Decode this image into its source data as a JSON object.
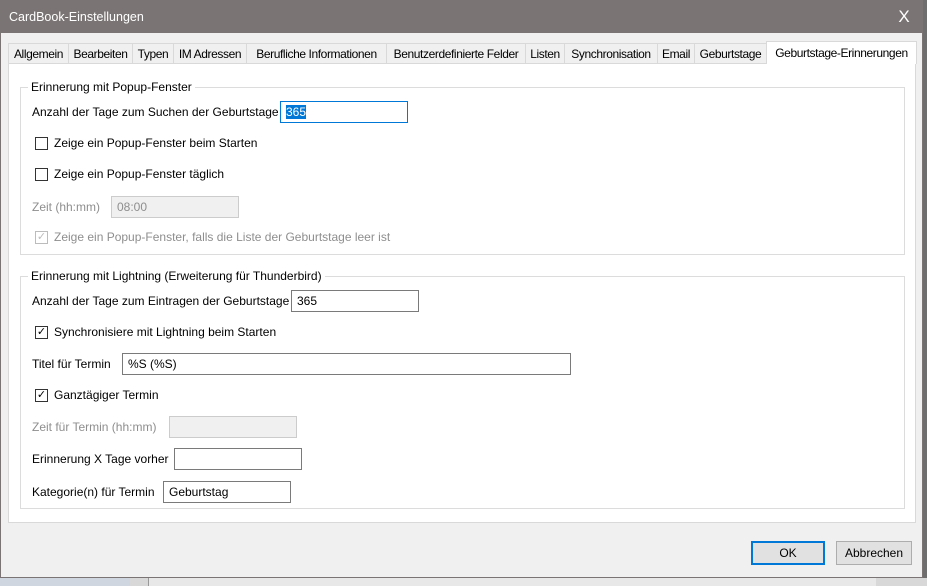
{
  "window": {
    "title": "CardBook-Einstellungen",
    "close_glyph": "X"
  },
  "tabs": [
    {
      "label": "Allgemein"
    },
    {
      "label": "Bearbeiten"
    },
    {
      "label": "Typen"
    },
    {
      "label": "IM Adressen"
    },
    {
      "label": "Berufliche Informationen"
    },
    {
      "label": "Benutzerdefinierte Felder"
    },
    {
      "label": "Listen"
    },
    {
      "label": "Synchronisation"
    },
    {
      "label": "Email"
    },
    {
      "label": "Geburtstage"
    },
    {
      "label": "Geburtstage-Erinnerungen",
      "active": true
    }
  ],
  "popup_group": {
    "legend": "Erinnerung mit Popup-Fenster",
    "days_label": "Anzahl der Tage zum Suchen der Geburtstage",
    "days_value": "365",
    "popup_on_start_label": "Zeige ein Popup-Fenster beim Starten",
    "popup_on_start_checked": false,
    "popup_daily_label": "Zeige ein Popup-Fenster täglich",
    "popup_daily_checked": false,
    "time_label": "Zeit (hh:mm)",
    "time_value": "08:00",
    "popup_if_empty_label": "Zeige ein Popup-Fenster, falls die Liste der Geburtstage leer ist",
    "popup_if_empty_checked": true
  },
  "lightning_group": {
    "legend": "Erinnerung mit Lightning (Erweiterung für Thunderbird)",
    "days_label": "Anzahl der Tage zum Eintragen der Geburtstage",
    "days_value": "365",
    "sync_label": "Synchronisiere mit Lightning beim Starten",
    "sync_checked": true,
    "title_label": "Titel für Termin",
    "title_value": "%S (%S)",
    "allday_label": "Ganztägiger Termin",
    "allday_checked": true,
    "event_time_label": "Zeit für Termin (hh:mm)",
    "event_time_value": "",
    "reminder_label": "Erinnerung X Tage vorher",
    "reminder_value": "",
    "category_label": "Kategorie(n) für Termin",
    "category_value": "Geburtstag"
  },
  "buttons": {
    "ok": "OK",
    "cancel": "Abbrechen"
  },
  "check_glyph": "✓"
}
